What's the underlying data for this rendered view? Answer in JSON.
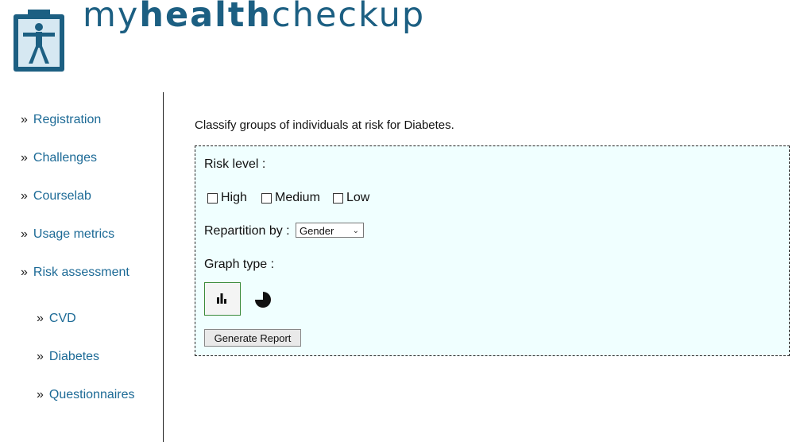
{
  "header": {
    "brand_prefix": "my",
    "brand_bold": "health",
    "brand_suffix": "checkup",
    "logo_icon": "person-clipboard-icon",
    "brand_color": "#1c5f82"
  },
  "sidebar": {
    "bullet": "»",
    "items": [
      {
        "label": "Registration"
      },
      {
        "label": "Challenges"
      },
      {
        "label": "Courselab"
      },
      {
        "label": "Usage metrics"
      },
      {
        "label": "Risk assessment"
      }
    ],
    "subitems": [
      {
        "label": "CVD"
      },
      {
        "label": "Diabetes"
      },
      {
        "label": "Questionnaires"
      }
    ],
    "link_color": "#1c6a96"
  },
  "main": {
    "intro": "Classify groups of individuals at risk for Diabetes.",
    "panel_bg": "#f0ffff",
    "risk_label": "Risk level :",
    "risk_options": [
      {
        "label": "High",
        "checked": false
      },
      {
        "label": "Medium",
        "checked": false
      },
      {
        "label": "Low",
        "checked": false
      }
    ],
    "repartition_label": "Repartition by :",
    "repartition_value": "Gender",
    "graph_label": "Graph type :",
    "graph_types": [
      "bar-chart-icon",
      "pie-chart-icon"
    ],
    "graph_selected": "bar-chart-icon",
    "generate_label": "Generate Report"
  }
}
